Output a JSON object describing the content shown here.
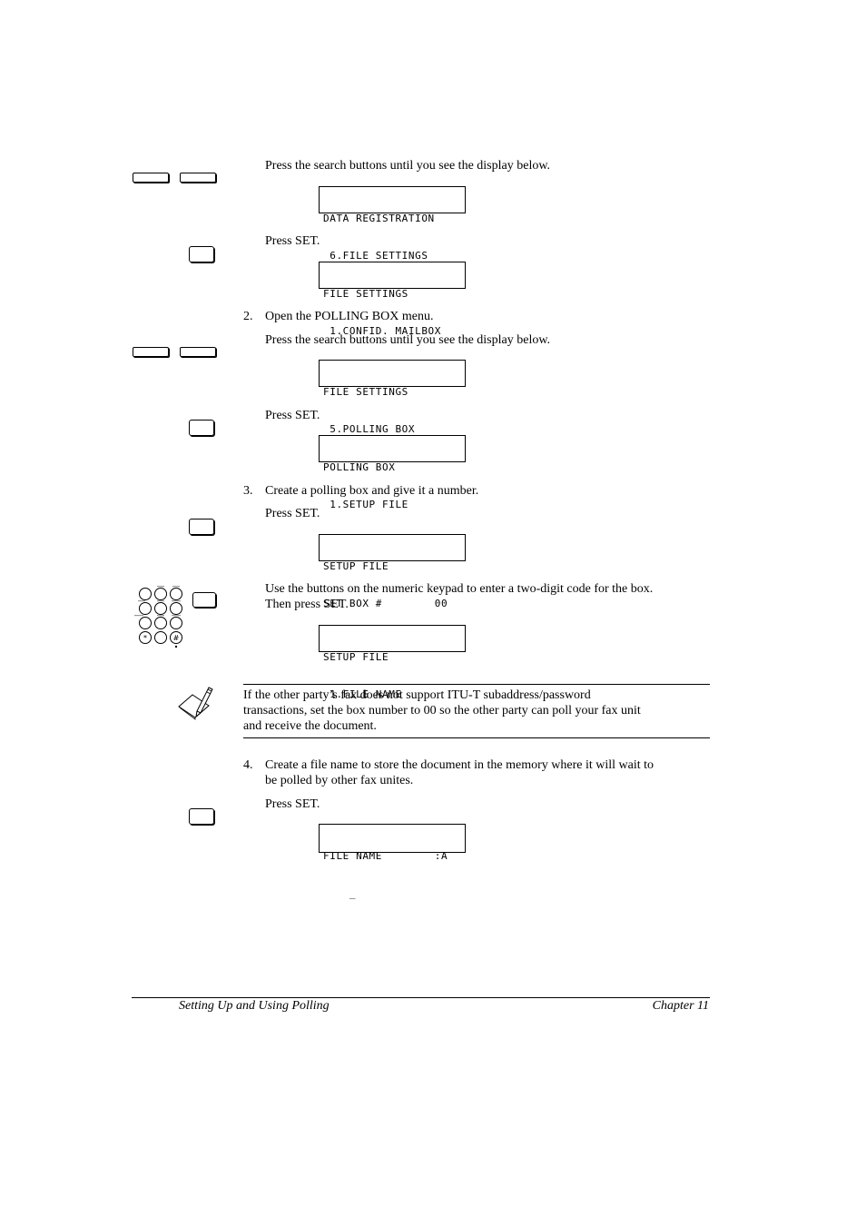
{
  "steps": [
    {
      "number": "",
      "title": "",
      "substeps": [
        {
          "instruction": "Press the search buttons until you see the display below.",
          "icon": "search-buttons-icon",
          "display": [
            "DATA REGISTRATION",
            " 6.FILE SETTINGS"
          ]
        },
        {
          "instruction": "Press SET.",
          "icon": "set-button-icon",
          "display": [
            "FILE SETTINGS",
            " 1.CONFID. MAILBOX"
          ]
        }
      ]
    },
    {
      "number": "2.",
      "title": "Open the POLLING BOX menu.",
      "substeps": [
        {
          "instruction": "Press the search buttons until you see the display below.",
          "icon": "search-buttons-icon",
          "display": [
            "FILE SETTINGS",
            " 5.POLLING BOX"
          ]
        },
        {
          "instruction": "Press SET.",
          "icon": "set-button-icon",
          "display": [
            "POLLING BOX",
            " 1.SETUP FILE"
          ]
        }
      ]
    },
    {
      "number": "3.",
      "title": "Create a polling box and give it a number.",
      "substeps": [
        {
          "instruction": "Press SET.",
          "icon": "set-button-icon",
          "display": [
            "SETUP FILE",
            "SET BOX #        00"
          ]
        },
        {
          "instruction_lines": [
            "Use the buttons on the numeric keypad to enter a two-digit code for the box.",
            "Then press SET."
          ],
          "icon": "keypad-icon",
          "display": [
            "SETUP FILE",
            " 1.FILE NAME"
          ]
        }
      ]
    },
    {
      "number": "4.",
      "title_lines": [
        "Create a file name to store the document in the memory where it will wait to",
        "be polled by other fax unites."
      ],
      "substeps": [
        {
          "instruction": "Press SET.",
          "icon": "set-button-icon",
          "display": [
            "FILE NAME        :A",
            "    _"
          ]
        }
      ]
    }
  ],
  "note": {
    "icon": "note-pencil-icon",
    "lines": [
      "If the other party’s fax does not support ITU-T subaddress/password",
      "transactions, set the box number to 00 so the other party can poll your fax unit",
      "and receive the document."
    ]
  },
  "footer": {
    "left": "Setting Up and Using Polling",
    "right": "Chapter 11"
  }
}
